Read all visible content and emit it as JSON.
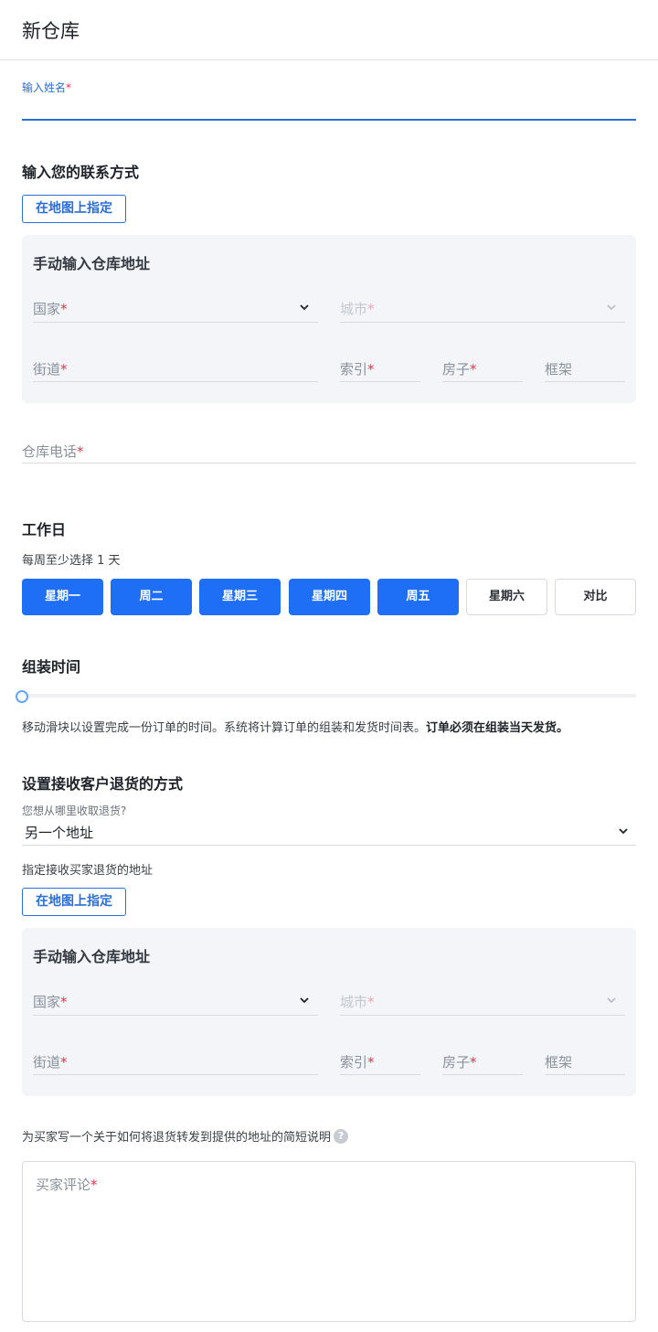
{
  "header": {
    "title": "新仓库"
  },
  "name_field": {
    "label": "输入姓名",
    "required": "*"
  },
  "contact": {
    "heading": "输入您的联系方式",
    "map_button": "在地图上指定",
    "manual": {
      "title": "手动输入仓库地址",
      "country": "国家",
      "city": "城市",
      "street": "街道",
      "index": "索引",
      "house": "房子",
      "frame": "框架",
      "required": "*"
    }
  },
  "phone": {
    "label": "仓库电话",
    "required": "*"
  },
  "workdays": {
    "heading": "工作日",
    "hint": "每周至少选择 1 天",
    "days": [
      {
        "label": "星期一",
        "selected": true
      },
      {
        "label": "周二",
        "selected": true
      },
      {
        "label": "星期三",
        "selected": true
      },
      {
        "label": "星期四",
        "selected": true
      },
      {
        "label": "周五",
        "selected": true
      },
      {
        "label": "星期六",
        "selected": false
      },
      {
        "label": "对比",
        "selected": false
      }
    ]
  },
  "assembly": {
    "heading": "组装时间",
    "slider_value": 0,
    "desc_normal": "移动滑块以设置完成一份订单的时间。系统将计算订单的组装和发货时间表。",
    "desc_bold": "订单必须在组装当天发货。"
  },
  "returns": {
    "heading": "设置接收客户退货的方式",
    "select_label": "您想从哪里收取退货?",
    "select_value": "另一个地址",
    "address_hint": "指定接收买家退货的地址",
    "map_button": "在地图上指定",
    "manual": {
      "title": "手动输入仓库地址",
      "country": "国家",
      "city": "城市",
      "street": "街道",
      "index": "索引",
      "house": "房子",
      "frame": "框架",
      "required": "*"
    },
    "note_hint": "为买家写一个关于如何将退货转发到提供的地址的简短说明",
    "help_glyph": "?",
    "comment_placeholder": "买家评论",
    "comment_required": "*"
  },
  "colors": {
    "accent": "#1e6ff5",
    "link": "#2a6ed8",
    "required": "#e5334b",
    "panel": "#f4f5f9"
  }
}
